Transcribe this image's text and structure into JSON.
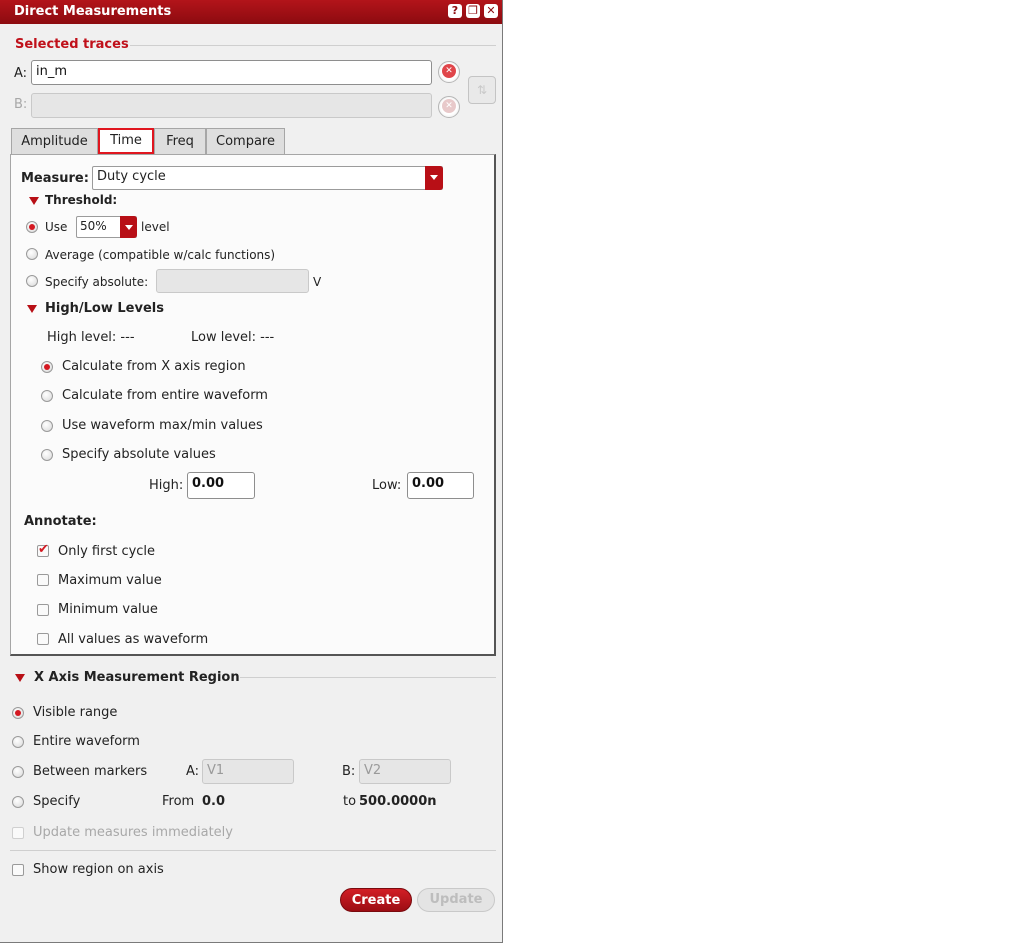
{
  "window": {
    "title": "Direct Measurements",
    "buttons": [
      "?",
      "restore",
      "close"
    ]
  },
  "traces": {
    "section_title": "Selected traces",
    "a_label": "A:",
    "a_value": "in_m",
    "b_label": "B:",
    "b_value": ""
  },
  "tabs": [
    "Amplitude",
    "Time",
    "Freq",
    "Compare"
  ],
  "active_tab": "Time",
  "measure": {
    "label": "Measure:",
    "value": "Duty cycle"
  },
  "threshold": {
    "title": "Threshold:",
    "use_label": "Use",
    "level_value": "50%",
    "level_suffix": "level",
    "average_label": "Average (compatible w/calc functions)",
    "absolute_label": "Specify absolute:",
    "absolute_unit": "V",
    "selected": "use"
  },
  "highlow": {
    "title": "High/Low Levels",
    "high_level_text": "High level: ---",
    "low_level_text": "Low level: ---",
    "options": [
      "Calculate from X axis region",
      "Calculate from entire waveform",
      "Use waveform max/min values",
      "Specify absolute values"
    ],
    "selected_index": 0,
    "high_label": "High:",
    "high_value": "0.00",
    "low_label": "Low:",
    "low_value": "0.00"
  },
  "annotate": {
    "title": "Annotate:",
    "options": [
      {
        "label": "Only first cycle",
        "checked": true
      },
      {
        "label": "Maximum value",
        "checked": false
      },
      {
        "label": "Minimum value",
        "checked": false
      },
      {
        "label": "All values as waveform",
        "checked": false
      }
    ]
  },
  "xaxis": {
    "title": "X Axis Measurement Region",
    "visible_range": "Visible range",
    "entire_waveform": "Entire waveform",
    "between_markers": "Between markers",
    "marker_a_label": "A:",
    "marker_a_value": "V1",
    "marker_b_label": "B:",
    "marker_b_value": "V2",
    "specify": "Specify",
    "from_label": "From",
    "from_value": "0.0",
    "to_label": "to",
    "to_value": "500.0000n",
    "update_immediately": "Update measures immediately",
    "selected": "visible_range"
  },
  "show_region": {
    "label": "Show region on axis",
    "checked": false
  },
  "actions": {
    "create": "Create",
    "update": "Update"
  },
  "colors": {
    "accent": "#c0101a",
    "title_bar": "#a31117"
  }
}
